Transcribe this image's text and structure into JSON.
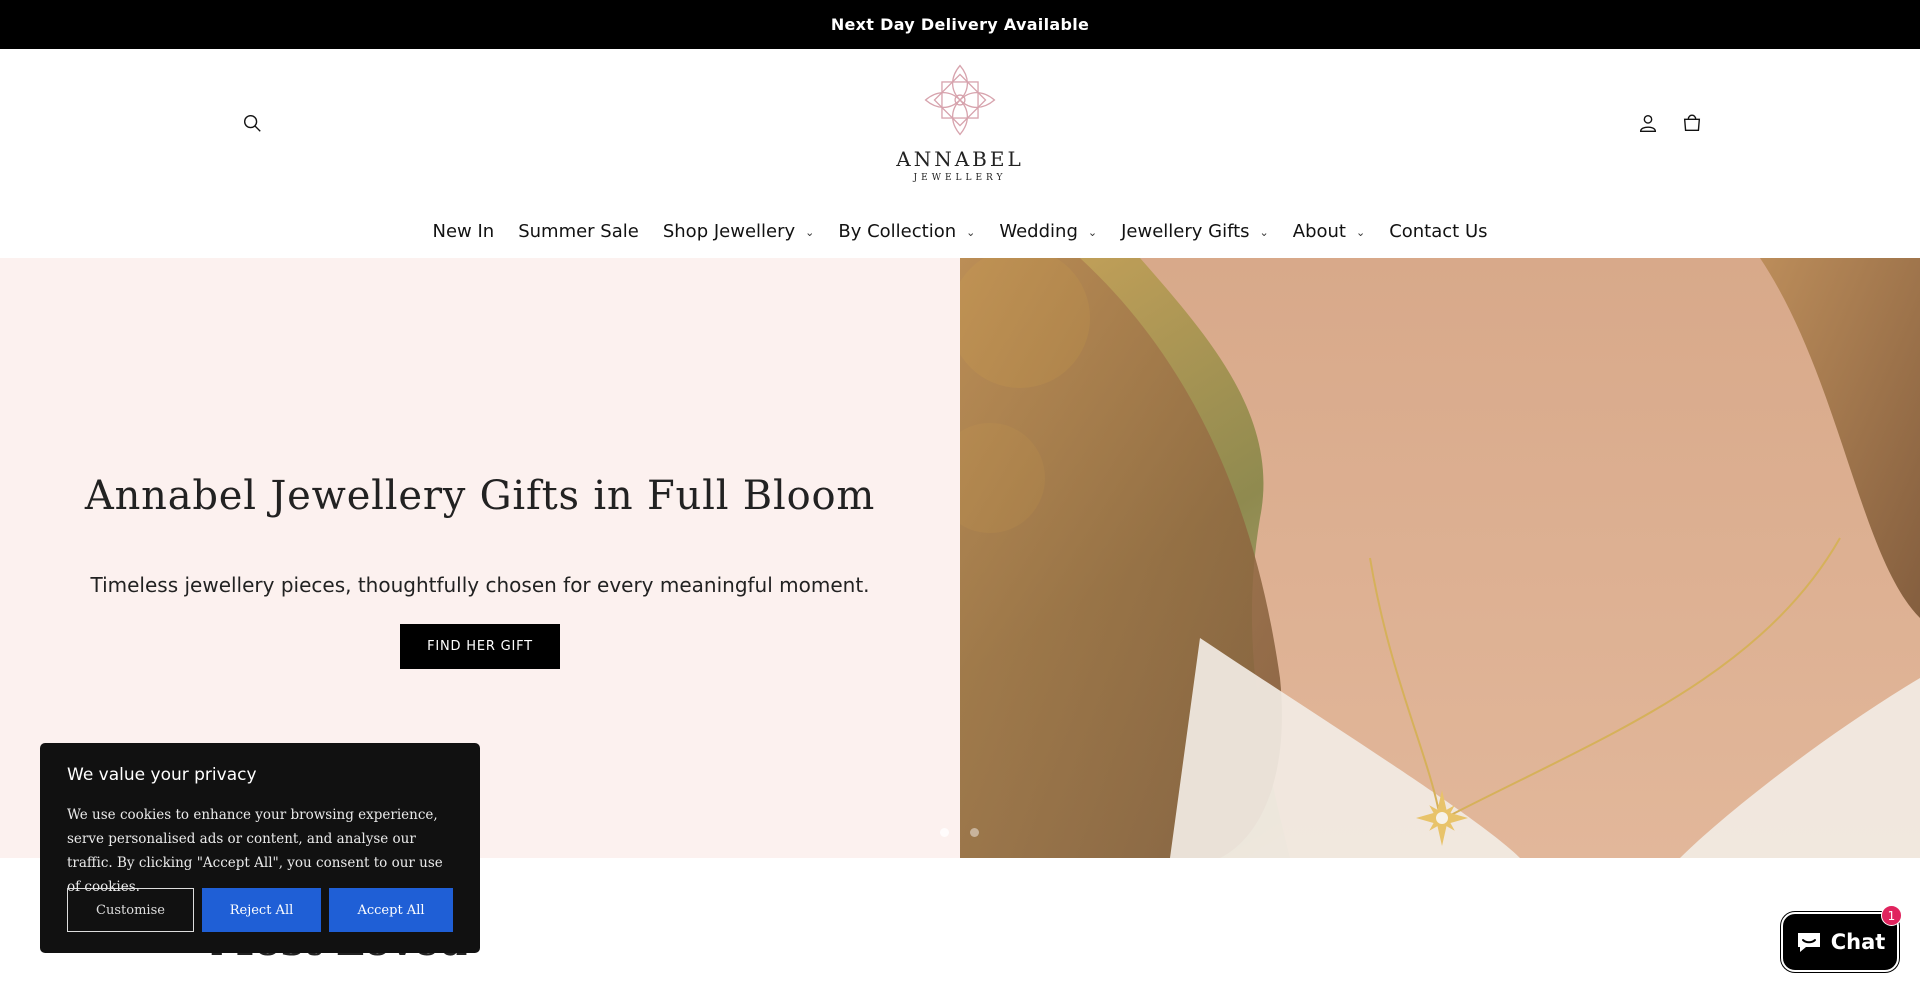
{
  "announcement": {
    "text": "Next Day Delivery Available"
  },
  "header": {
    "logo": {
      "name": "ANNABEL",
      "sub": "JEWELLERY"
    },
    "icons": {
      "search": "search-icon",
      "account": "account-icon",
      "cart": "cart-icon"
    }
  },
  "nav": {
    "items": [
      {
        "label": "New In",
        "dropdown": false
      },
      {
        "label": "Summer Sale",
        "dropdown": false
      },
      {
        "label": "Shop Jewellery",
        "dropdown": true
      },
      {
        "label": "By Collection",
        "dropdown": true
      },
      {
        "label": "Wedding",
        "dropdown": true
      },
      {
        "label": "Jewellery Gifts",
        "dropdown": true
      },
      {
        "label": "About",
        "dropdown": true
      },
      {
        "label": "Contact Us",
        "dropdown": false
      }
    ],
    "chevron": "⌄"
  },
  "hero": {
    "title": "Annabel Jewellery Gifts in Full Bloom",
    "subtitle": "Timeless jewellery pieces, thoughtfully chosen for every meaningful moment.",
    "cta": "FIND HER GIFT",
    "bg_color": "#fcf1ef"
  },
  "section": {
    "title": "Most Loved"
  },
  "cookie": {
    "title": "We value your privacy",
    "text": "We use cookies to enhance your browsing experience, serve personalised ads or content, and analyse our traffic. By clicking \"Accept All\", you consent to our use of cookies.",
    "customise": "Customise",
    "reject": "Reject All",
    "accept": "Accept All",
    "button_color": "#1f5fd6"
  },
  "chat": {
    "label": "Chat",
    "badge": "1"
  }
}
